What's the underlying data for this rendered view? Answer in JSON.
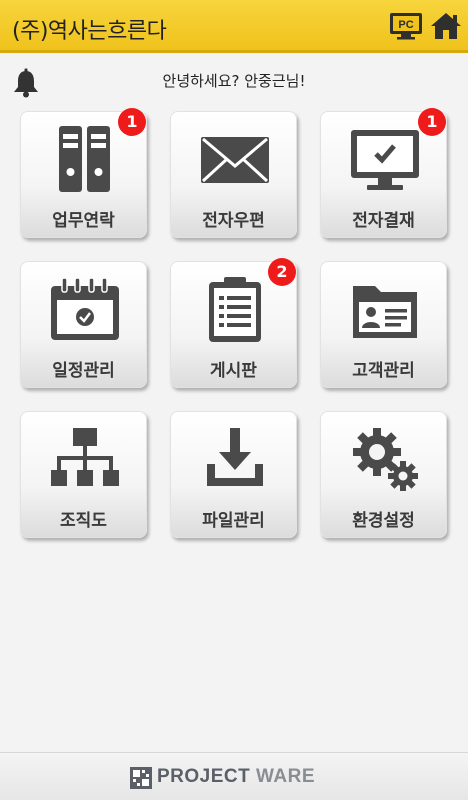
{
  "header": {
    "title": "(주)역사는흐른다",
    "pc_label": "PC"
  },
  "greeting": "안녕하세요? 안중근님!",
  "tiles": [
    {
      "label": "업무연락",
      "icon": "binders-icon",
      "badge": "1"
    },
    {
      "label": "전자우편",
      "icon": "envelope-icon",
      "badge": ""
    },
    {
      "label": "전자결재",
      "icon": "monitor-check-icon",
      "badge": "1"
    },
    {
      "label": "일정관리",
      "icon": "calendar-icon",
      "badge": ""
    },
    {
      "label": "게시판",
      "icon": "clipboard-icon",
      "badge": "2"
    },
    {
      "label": "고객관리",
      "icon": "contact-folder-icon",
      "badge": ""
    },
    {
      "label": "조직도",
      "icon": "org-chart-icon",
      "badge": ""
    },
    {
      "label": "파일관리",
      "icon": "download-icon",
      "badge": ""
    },
    {
      "label": "환경설정",
      "icon": "gears-icon",
      "badge": ""
    }
  ],
  "footer": {
    "brand_part1": "PROJECT",
    "brand_part2": "WARE"
  },
  "colors": {
    "header_yellow": "#f0c21c",
    "badge_red": "#ef1a1a",
    "icon_gray": "#4a4a4a"
  }
}
